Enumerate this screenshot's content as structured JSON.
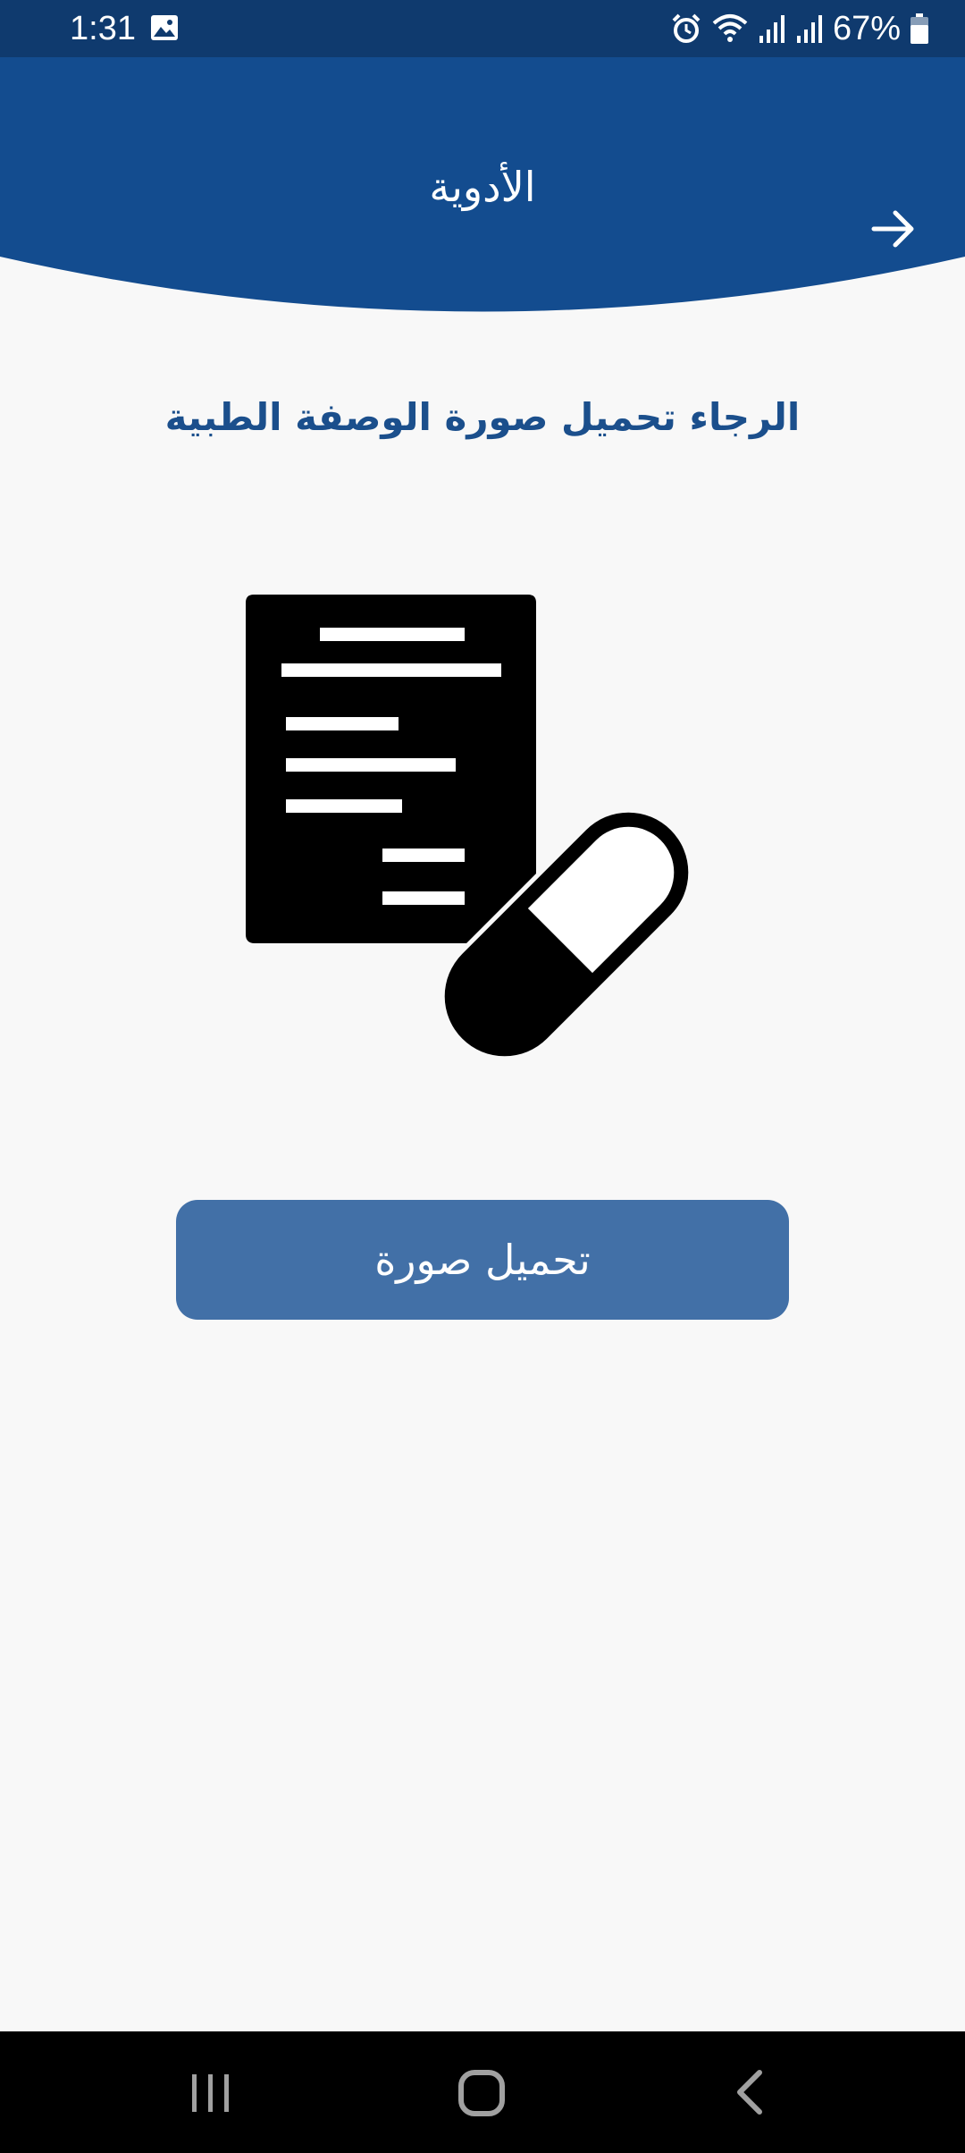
{
  "status_bar": {
    "time": "1:31",
    "battery_text": "67%",
    "icons": [
      "gallery-icon",
      "alarm-icon",
      "wifi-icon",
      "signal-icon",
      "signal-icon",
      "battery-icon"
    ]
  },
  "header": {
    "title": "الأدوية",
    "back_icon": "arrow-right-icon"
  },
  "main": {
    "instruction": "الرجاء تحميل صورة الوصفة الطبية",
    "illustration_icon": "prescription-pill-icon",
    "upload_button_label": "تحميل صورة"
  },
  "nav_bar": {
    "icons": [
      "recents-icon",
      "home-icon",
      "back-icon"
    ]
  },
  "colors": {
    "status_bar": "#0f3a6e",
    "header": "#134c8f",
    "accent_text": "#1b4f8c",
    "button": "#4270a7",
    "background": "#f8f8f8"
  }
}
